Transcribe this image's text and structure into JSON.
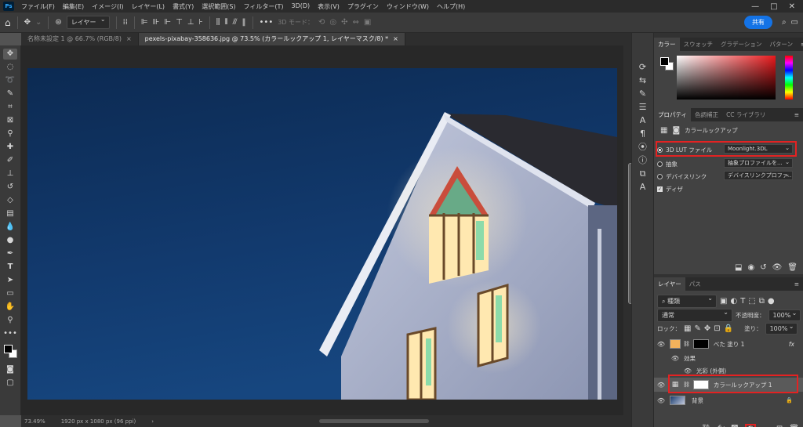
{
  "app": {
    "logo": "Ps"
  },
  "menu": [
    "ファイル(F)",
    "編集(E)",
    "イメージ(I)",
    "レイヤー(L)",
    "書式(Y)",
    "選択範囲(S)",
    "フィルター(T)",
    "3D(D)",
    "表示(V)",
    "プラグイン",
    "ウィンドウ(W)",
    "ヘルプ(H)"
  ],
  "window_buttons": [
    "—",
    "□",
    "✕"
  ],
  "options": {
    "layer_select": "レイヤー",
    "mode_3d": "3D モード：",
    "more": "•••",
    "share": "共有"
  },
  "tabs": [
    {
      "label": "名称未設定 1 @ 66.7% (RGB/8)",
      "close": "×",
      "active": false
    },
    {
      "label": "pexels-pixabay-358636.jpg @ 73.5% (カラールックアップ 1, レイヤーマスク/8) *",
      "close": "×",
      "active": true
    }
  ],
  "status": {
    "zoom": "73.49%",
    "doc_size": "1920 px x 1080 px (96 ppi)",
    "arrow": "›"
  },
  "color_panel": {
    "tabs": [
      "カラー",
      "スウォッチ",
      "グラデーション",
      "パターン"
    ]
  },
  "properties_panel": {
    "tabs": [
      "プロパティ",
      "色調補正",
      "CC ライブラリ"
    ],
    "title": "カラールックアップ",
    "lut_label": "3D LUT ファイル",
    "lut_value": "Moonlight.3DL",
    "abstract_label": "抽象",
    "abstract_value": "抽象プロファイルを...",
    "devicelink_label": "デバイスリンク",
    "devicelink_value": "デバイスリンクプロファ...",
    "dither_label": "ディザ"
  },
  "layers_panel": {
    "tabs": [
      "レイヤー",
      "パス"
    ],
    "filter_kind": "種類",
    "blend_mode": "通常",
    "opacity_label": "不透明度：",
    "opacity_value": "100%",
    "lock_label": "ロック：",
    "fill_label": "塗り：",
    "fill_value": "100%",
    "layers": [
      {
        "name": "べた 塗り 1",
        "fx": "fx"
      },
      {
        "name": "効果"
      },
      {
        "name": "光彩 (外側)"
      },
      {
        "name": "カラールックアップ 1"
      },
      {
        "name": "背景"
      }
    ]
  },
  "highlight_color": "#e32222"
}
